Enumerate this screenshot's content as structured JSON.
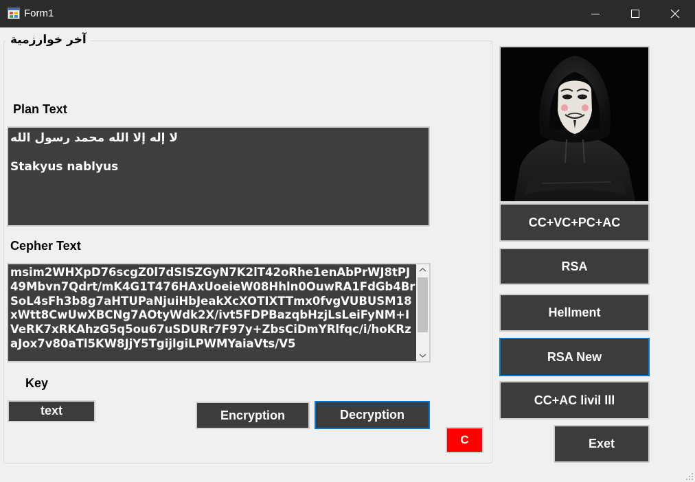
{
  "window": {
    "title": "Form1"
  },
  "group": {
    "title": "آخر خوارزمية"
  },
  "plain": {
    "label": "Plan Text",
    "line1": "لا إله إلا الله محمد رسول الله",
    "line2": "Stakyus nablyus"
  },
  "cipher": {
    "label": "Cepher Text",
    "value": "msim2WHXpD76scgZ0l7dSISZGyN7K2lT42oRhe1enAbPrWJ8tPJ49Mbvn7Qdrt/mK4G1T476HAxUoeieW08Hhln0OuwRA1FdGb4BrSoL4sFh3b8g7aHTUPaNjuiHbJeakXcXOTIXTTmx0fvgVUBUSM18xWtt8CwUwXBCNg7AOtyWdk2X/ivt5FDPBazqbHzjLsLeiFyNM+IVeRK7xRKAhzG5q5ou67uSDURr7F97y+ZbsCiDmYRlfqc/i/hoKRzaJox7v80aTl5KW8JjY5TgijlgiLPWMYaiaVts/V5"
  },
  "key": {
    "label": "Key",
    "value": "text"
  },
  "buttons": {
    "encryption": "Encryption",
    "decryption": "Decryption",
    "clear": "C",
    "algo1": "CC+VC+PC+AC",
    "algo2": "RSA",
    "algo3": "Hellment",
    "algo4": "RSA New",
    "algo5": "CC+AC livil lll",
    "exit": "Exet"
  },
  "colors": {
    "titlebar": "#2b2b2b",
    "button_bg": "#3c3c3c",
    "focus": "#0078d7",
    "clear_btn": "#ff0000"
  },
  "icons": {
    "window": "form-app-icon",
    "minimize": "minimize-icon",
    "maximize": "maximize-icon",
    "close": "close-icon"
  }
}
